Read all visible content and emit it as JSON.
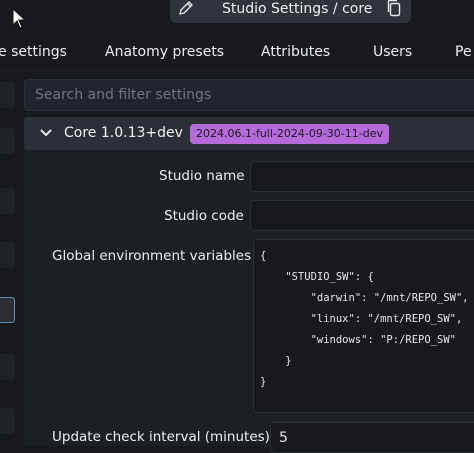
{
  "window": {
    "title": "Studio Settings / core"
  },
  "tabs": [
    {
      "label": "e settings"
    },
    {
      "label": "Anatomy presets"
    },
    {
      "label": "Attributes"
    },
    {
      "label": "Users"
    },
    {
      "label": "Pe"
    }
  ],
  "search": {
    "placeholder": "Search and filter settings",
    "value": ""
  },
  "section": {
    "title": "Core 1.0.13+dev",
    "badge": "2024.06.1-full-2024-09-30-11-dev",
    "badge_color": "#b46bd9"
  },
  "fields": {
    "studio_name": {
      "label": "Studio name",
      "value": ""
    },
    "studio_code": {
      "label": "Studio code",
      "value": ""
    },
    "global_env": {
      "label": "Global environment variables",
      "lines": [
        "{",
        "    \"STUDIO_SW\": {",
        "        \"darwin\": \"/mnt/REPO_SW\",",
        "        \"linux\": \"/mnt/REPO_SW\",",
        "        \"windows\": \"P:/REPO_SW\"",
        "    }",
        "}"
      ]
    },
    "update_interval": {
      "label": "Update check interval (minutes)",
      "value": "5"
    }
  },
  "icons": {
    "cursor": "mouse-pointer-icon",
    "title_edit": "pencil-icon",
    "title_copy": "copy-icon",
    "section_toggle": "chevron-down-icon",
    "left_toolbar": "panel-icon"
  },
  "colors": {
    "accent": "#5b90b8",
    "badge": "#b46bd9"
  }
}
